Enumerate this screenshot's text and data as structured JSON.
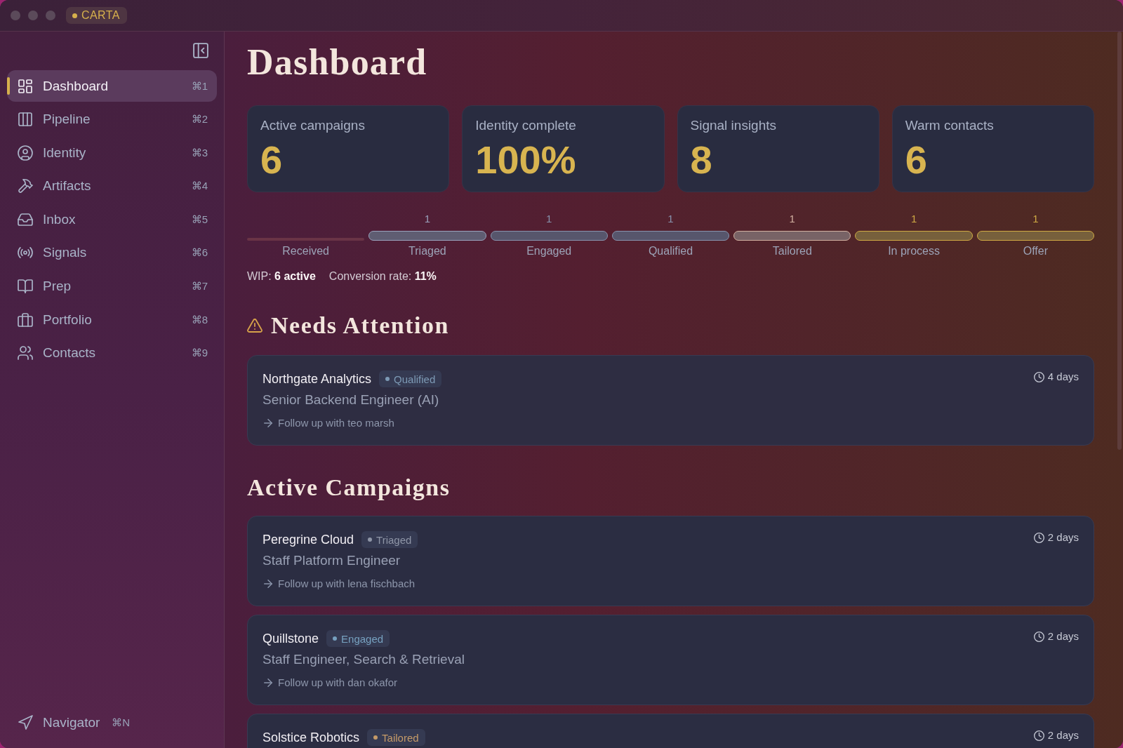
{
  "window": {
    "app_badge": "CARTA"
  },
  "sidebar": {
    "items": [
      {
        "label": "Dashboard",
        "shortcut": "⌘1",
        "selected": true
      },
      {
        "label": "Pipeline",
        "shortcut": "⌘2",
        "selected": false
      },
      {
        "label": "Identity",
        "shortcut": "⌘3",
        "selected": false
      },
      {
        "label": "Artifacts",
        "shortcut": "⌘4",
        "selected": false
      },
      {
        "label": "Inbox",
        "shortcut": "⌘5",
        "selected": false
      },
      {
        "label": "Signals",
        "shortcut": "⌘6",
        "selected": false
      },
      {
        "label": "Prep",
        "shortcut": "⌘7",
        "selected": false
      },
      {
        "label": "Portfolio",
        "shortcut": "⌘8",
        "selected": false
      },
      {
        "label": "Contacts",
        "shortcut": "⌘9",
        "selected": false
      }
    ],
    "footer": {
      "label": "Navigator",
      "shortcut": "⌘N"
    }
  },
  "dashboard": {
    "title": "Dashboard",
    "stats": [
      {
        "label": "Active campaigns",
        "value": "6"
      },
      {
        "label": "Identity complete",
        "value": "100%"
      },
      {
        "label": "Signal insights",
        "value": "8"
      },
      {
        "label": "Warm contacts",
        "value": "6"
      }
    ],
    "pipeline": {
      "stages": [
        {
          "label": "Received",
          "kind": "empty",
          "color": "#6a3446"
        },
        {
          "label": "Triaged",
          "kind": "filled",
          "count": "1",
          "color": "#9aa2bc"
        },
        {
          "label": "Engaged",
          "kind": "filled",
          "count": "1",
          "color": "#8793ad"
        },
        {
          "label": "Qualified",
          "kind": "filled",
          "count": "1",
          "color": "#8793ad"
        },
        {
          "label": "Tailored",
          "kind": "filled",
          "count": "1",
          "color": "#d2b0a0"
        },
        {
          "label": "In process",
          "kind": "filled",
          "count": "1",
          "color": "#d0aa44"
        },
        {
          "label": "Offer",
          "kind": "filled",
          "count": "1",
          "color": "#d0aa44"
        }
      ]
    },
    "summary": [
      "WIP: **6 active**",
      "Conversion rate: **11%**"
    ],
    "needs_attention": {
      "heading": "Needs Attention",
      "items": [
        {
          "company": "Northgate Analytics",
          "status": "Qualified",
          "color": "#7d9ab5",
          "role": "Senior Backend Engineer (AI)",
          "next_step": "Follow up with teo marsh",
          "age": "4 days"
        }
      ]
    },
    "active_campaigns": {
      "heading": "Active Campaigns",
      "items": [
        {
          "company": "Peregrine Cloud",
          "status": "Triaged",
          "color": "#8e95a6",
          "role": "Staff Platform Engineer",
          "next_step": "Follow up with lena fischbach",
          "age": "2 days"
        },
        {
          "company": "Quillstone",
          "status": "Engaged",
          "color": "#76a0bf",
          "role": "Staff Engineer, Search & Retrieval",
          "next_step": "Follow up with dan okafor",
          "age": "2 days"
        },
        {
          "company": "Solstice Robotics",
          "status": "Tailored",
          "color": "#c49a68",
          "age": "2 days"
        }
      ]
    }
  }
}
